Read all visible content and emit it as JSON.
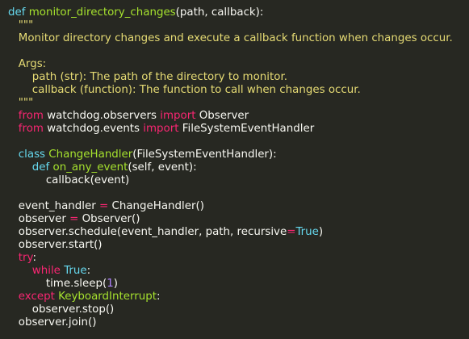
{
  "editor": {
    "lines": [
      [
        {
          "t": "def ",
          "k": "def"
        },
        {
          "t": "monitor_directory_changes",
          "k": "func"
        },
        {
          "t": "(path, callback):",
          "k": "plain"
        }
      ],
      [
        {
          "t": "   \"\"\"",
          "k": "string"
        }
      ],
      [
        {
          "t": "   Monitor directory changes and execute a callback function when changes occur.",
          "k": "string"
        }
      ],
      [
        {
          "t": "",
          "k": "plain"
        }
      ],
      [
        {
          "t": "   Args:",
          "k": "string"
        }
      ],
      [
        {
          "t": "       path (str): The path of the directory to monitor.",
          "k": "string"
        }
      ],
      [
        {
          "t": "       callback (function): The function to call when changes occur.",
          "k": "string"
        }
      ],
      [
        {
          "t": "   \"\"\"",
          "k": "string"
        }
      ],
      [
        {
          "t": "   ",
          "k": "plain"
        },
        {
          "t": "from",
          "k": "keyword"
        },
        {
          "t": " watchdog.observers ",
          "k": "plain"
        },
        {
          "t": "import",
          "k": "keyword"
        },
        {
          "t": " Observer",
          "k": "plain"
        }
      ],
      [
        {
          "t": "   ",
          "k": "plain"
        },
        {
          "t": "from",
          "k": "keyword"
        },
        {
          "t": " watchdog.events ",
          "k": "plain"
        },
        {
          "t": "import",
          "k": "keyword"
        },
        {
          "t": " FileSystemEventHandler",
          "k": "plain"
        }
      ],
      [
        {
          "t": "",
          "k": "plain"
        }
      ],
      [
        {
          "t": "   ",
          "k": "plain"
        },
        {
          "t": "class ",
          "k": "def"
        },
        {
          "t": "ChangeHandler",
          "k": "class"
        },
        {
          "t": "(FileSystemEventHandler):",
          "k": "plain"
        }
      ],
      [
        {
          "t": "       ",
          "k": "plain"
        },
        {
          "t": "def ",
          "k": "def"
        },
        {
          "t": "on_any_event",
          "k": "func"
        },
        {
          "t": "(self, event):",
          "k": "plain"
        }
      ],
      [
        {
          "t": "           callback(event)",
          "k": "plain"
        }
      ],
      [
        {
          "t": "",
          "k": "plain"
        }
      ],
      [
        {
          "t": "   event_handler ",
          "k": "plain"
        },
        {
          "t": "=",
          "k": "keyword"
        },
        {
          "t": " ChangeHandler()",
          "k": "plain"
        }
      ],
      [
        {
          "t": "   observer ",
          "k": "plain"
        },
        {
          "t": "=",
          "k": "keyword"
        },
        {
          "t": " Observer()",
          "k": "plain"
        }
      ],
      [
        {
          "t": "   observer.schedule(event_handler, path, recursive",
          "k": "plain"
        },
        {
          "t": "=",
          "k": "keyword"
        },
        {
          "t": "True",
          "k": "constant"
        },
        {
          "t": ")",
          "k": "plain"
        }
      ],
      [
        {
          "t": "   observer.start()",
          "k": "plain"
        }
      ],
      [
        {
          "t": "   ",
          "k": "plain"
        },
        {
          "t": "try",
          "k": "keyword"
        },
        {
          "t": ":",
          "k": "plain"
        }
      ],
      [
        {
          "t": "       ",
          "k": "plain"
        },
        {
          "t": "while",
          "k": "keyword"
        },
        {
          "t": " ",
          "k": "plain"
        },
        {
          "t": "True",
          "k": "constant"
        },
        {
          "t": ":",
          "k": "plain"
        }
      ],
      [
        {
          "t": "           time.sleep(",
          "k": "plain"
        },
        {
          "t": "1",
          "k": "number"
        },
        {
          "t": ")",
          "k": "plain"
        }
      ],
      [
        {
          "t": "   ",
          "k": "plain"
        },
        {
          "t": "except",
          "k": "keyword"
        },
        {
          "t": " ",
          "k": "plain"
        },
        {
          "t": "KeyboardInterrupt",
          "k": "class"
        },
        {
          "t": ":",
          "k": "plain"
        }
      ],
      [
        {
          "t": "       observer.stop()",
          "k": "plain"
        }
      ],
      [
        {
          "t": "   observer.join()",
          "k": "plain"
        }
      ]
    ]
  },
  "colors": {
    "background": "#272822",
    "plain": "#f8f8f2",
    "keyword": "#f92672",
    "def": "#66d9ef",
    "func": "#a6e22e",
    "string": "#e6db74",
    "number": "#ae81ff",
    "constant": "#66d9ef",
    "class": "#a6e22e"
  }
}
